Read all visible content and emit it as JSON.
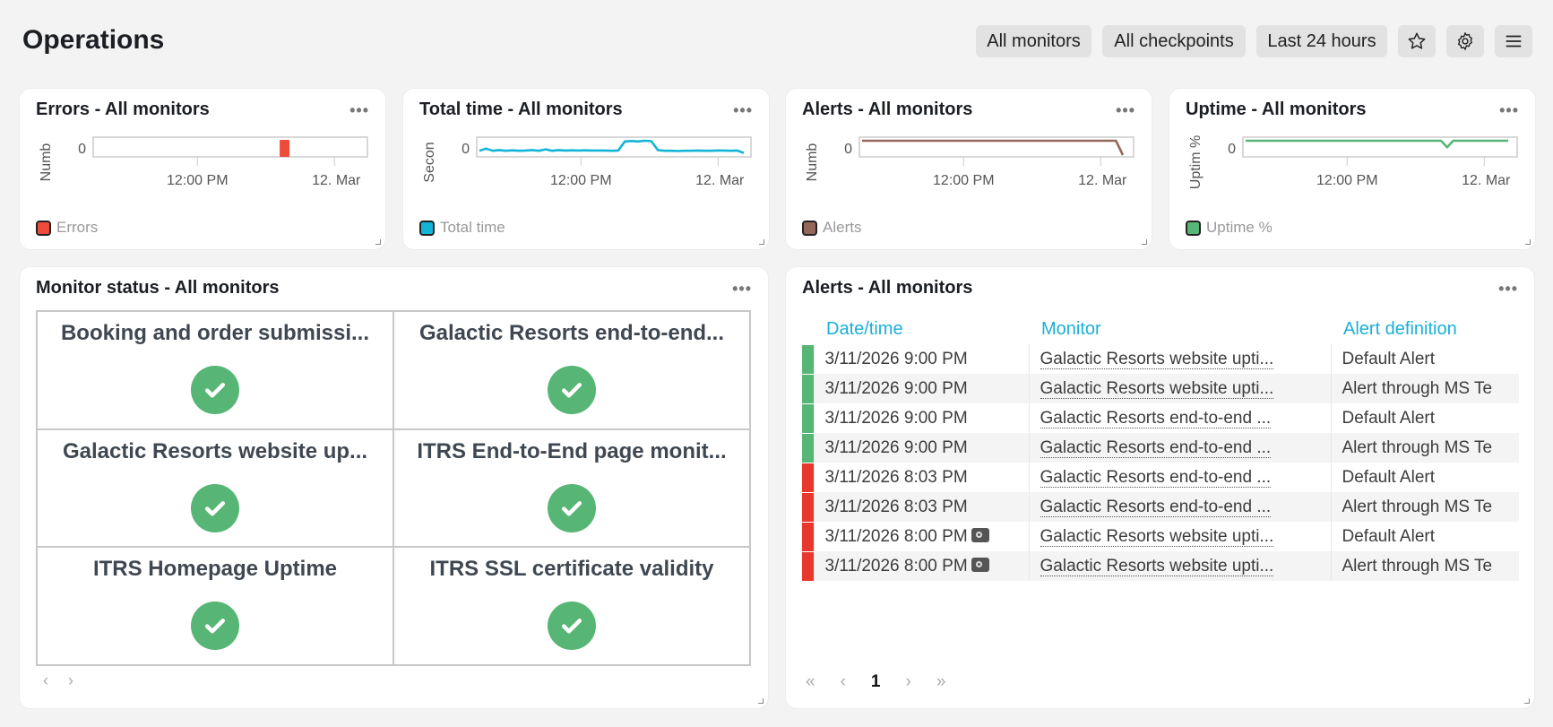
{
  "header": {
    "title": "Operations",
    "filters": [
      "All monitors",
      "All checkpoints",
      "Last 24 hours"
    ],
    "icons": [
      "star-icon",
      "gear-icon",
      "menu-icon"
    ]
  },
  "charts": [
    {
      "title": "Errors - All monitors",
      "ylabel": "Numb",
      "ytick": "0",
      "xticks": [
        "12:00 PM",
        "12. Mar"
      ],
      "legend": "Errors",
      "color": "#ef4b3a",
      "type": "bar",
      "bar_at": 0.68
    },
    {
      "title": "Total time - All monitors",
      "ylabel": "Secon",
      "ytick": "0",
      "xticks": [
        "12:00 PM",
        "12. Mar"
      ],
      "legend": "Total time",
      "color": "#13b5d7",
      "type": "line",
      "values": [
        0.3,
        0.45,
        0.3,
        0.35,
        0.3,
        0.33,
        0.3,
        0.32,
        0.35,
        0.3,
        0.4,
        0.3,
        0.35,
        0.32,
        0.33,
        0.32,
        0.33,
        0.32,
        0.32,
        0.32,
        0.3,
        0.32,
        0.95,
        0.98,
        0.95,
        1.0,
        0.97,
        0.35,
        0.3,
        0.3,
        0.28,
        0.3,
        0.3,
        0.32,
        0.3,
        0.3,
        0.32,
        0.32,
        0.3,
        0.32,
        0.15
      ]
    },
    {
      "title": "Alerts - All monitors",
      "ylabel": "Numb",
      "ytick": "0",
      "xticks": [
        "12:00 PM",
        "12. Mar"
      ],
      "legend": "Alerts",
      "color": "#93685a",
      "type": "line",
      "values": [
        1,
        1,
        1,
        1,
        1,
        1,
        1,
        1,
        1,
        1,
        1,
        1,
        1,
        1,
        1,
        1,
        1,
        1,
        1,
        1,
        1,
        1,
        1,
        1,
        1,
        1,
        1,
        1,
        1,
        1,
        1,
        1,
        1,
        1,
        1,
        1,
        1,
        1,
        0
      ]
    },
    {
      "title": "Uptime - All monitors",
      "ylabel": "Uptim %",
      "ytick": "0",
      "xticks": [
        "12:00 PM",
        "12. Mar"
      ],
      "legend": "Uptime %",
      "color": "#57b675",
      "type": "line",
      "values": [
        1,
        1,
        1,
        1,
        1,
        1,
        1,
        1,
        1,
        1,
        1,
        1,
        1,
        1,
        1,
        1,
        1,
        1,
        1,
        1,
        1,
        1,
        1,
        1,
        1,
        1,
        1,
        1,
        1,
        1,
        1,
        1,
        1,
        0.55,
        1,
        1,
        1,
        1,
        1,
        1,
        1,
        1,
        1,
        1
      ]
    }
  ],
  "monitor_status": {
    "title": "Monitor status - All monitors",
    "items": [
      {
        "name": "Booking and order submissi...",
        "status": "ok"
      },
      {
        "name": "Galactic Resorts end-to-end...",
        "status": "ok"
      },
      {
        "name": "Galactic Resorts website up...",
        "status": "ok"
      },
      {
        "name": "ITRS End-to-End page monit...",
        "status": "ok"
      },
      {
        "name": "ITRS Homepage Uptime",
        "status": "ok"
      },
      {
        "name": "ITRS SSL certificate validity",
        "status": "ok"
      }
    ],
    "pager": {
      "prev": "‹",
      "next": "›"
    }
  },
  "alerts": {
    "title": "Alerts - All monitors",
    "columns": [
      "Date/time",
      "Monitor",
      "Alert definition"
    ],
    "rows": [
      {
        "status": "#57b675",
        "datetime": "3/11/2026 9:00 PM",
        "monitor": "Galactic Resorts website upti...",
        "definition": "Default Alert",
        "camera": false
      },
      {
        "status": "#57b675",
        "datetime": "3/11/2026 9:00 PM",
        "monitor": "Galactic Resorts website upti...",
        "definition": "Alert through MS Te",
        "camera": false
      },
      {
        "status": "#57b675",
        "datetime": "3/11/2026 9:00 PM",
        "monitor": "Galactic Resorts end-to-end ...",
        "definition": "Default Alert",
        "camera": false
      },
      {
        "status": "#57b675",
        "datetime": "3/11/2026 9:00 PM",
        "monitor": "Galactic Resorts end-to-end ...",
        "definition": "Alert through MS Te",
        "camera": false
      },
      {
        "status": "#e8372c",
        "datetime": "3/11/2026 8:03 PM",
        "monitor": "Galactic Resorts end-to-end ...",
        "definition": "Default Alert",
        "camera": false
      },
      {
        "status": "#e8372c",
        "datetime": "3/11/2026 8:03 PM",
        "monitor": "Galactic Resorts end-to-end ...",
        "definition": "Alert through MS Te",
        "camera": false
      },
      {
        "status": "#e8372c",
        "datetime": "3/11/2026 8:00 PM",
        "monitor": "Galactic Resorts website upti...",
        "definition": "Default Alert",
        "camera": true
      },
      {
        "status": "#e8372c",
        "datetime": "3/11/2026 8:00 PM",
        "monitor": "Galactic Resorts website upti...",
        "definition": "Alert through MS Te",
        "camera": true
      }
    ],
    "pager": {
      "first": "«",
      "prev": "‹",
      "page": "1",
      "next": "›",
      "last": "»"
    }
  }
}
